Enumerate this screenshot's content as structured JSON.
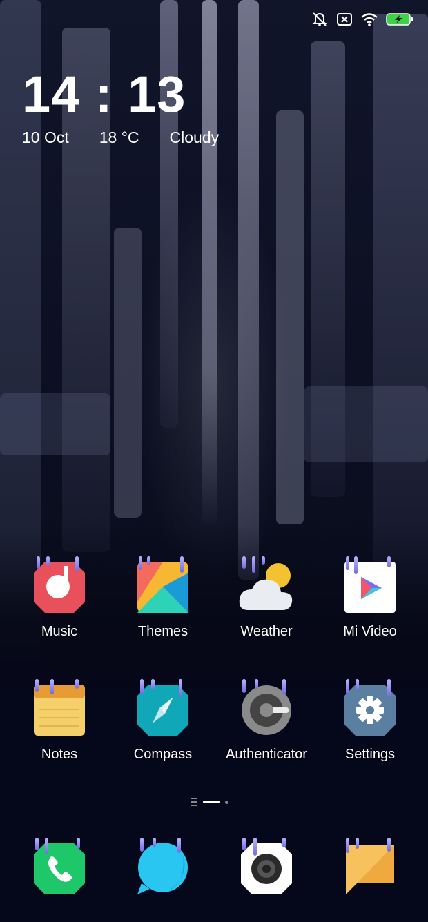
{
  "status_bar": {
    "icons": [
      "silent-bell-icon",
      "no-sim-icon",
      "wifi-icon",
      "battery-charging-icon"
    ],
    "battery_color": "#3fd14a"
  },
  "clock_widget": {
    "time": "14:13",
    "date": "10 Oct",
    "temperature": "18 °C",
    "condition": "Cloudy"
  },
  "apps": [
    {
      "label": "Music",
      "icon": "music-icon",
      "color": "#e8505b"
    },
    {
      "label": "Themes",
      "icon": "themes-icon",
      "color": "#f7b733"
    },
    {
      "label": "Weather",
      "icon": "weather-icon",
      "color": "#f2c230"
    },
    {
      "label": "Mi Video",
      "icon": "mi-video-icon",
      "color": "#ffffff"
    },
    {
      "label": "Notes",
      "icon": "notes-icon",
      "color": "#f5d06a"
    },
    {
      "label": "Compass",
      "icon": "compass-icon",
      "color": "#10a8b8"
    },
    {
      "label": "Authenticator",
      "icon": "authenticator-icon",
      "color": "#5a5a5a"
    },
    {
      "label": "Settings",
      "icon": "settings-icon",
      "color": "#5b7fa0"
    }
  ],
  "dock": [
    {
      "icon": "phone-icon",
      "color": "#1ec86a"
    },
    {
      "icon": "messages-icon",
      "color": "#29c6f2"
    },
    {
      "icon": "camera-icon",
      "color": "#ffffff"
    },
    {
      "icon": "chat-icon",
      "color": "#f5b74a"
    }
  ],
  "page_indicator": {
    "pages": 2,
    "current": 1
  }
}
